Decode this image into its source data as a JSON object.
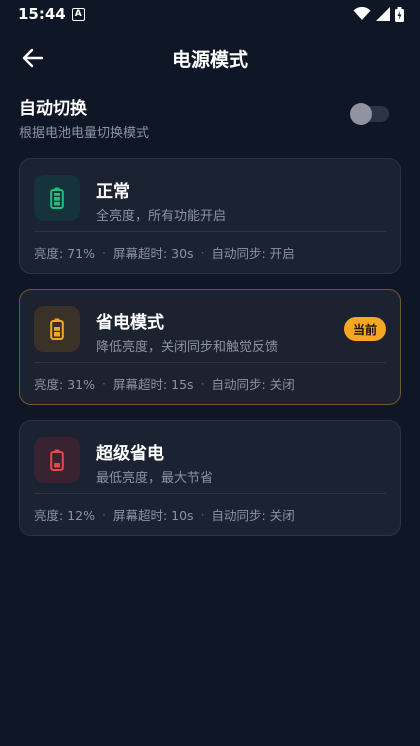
{
  "status_bar": {
    "time": "15:44",
    "a_label": "A"
  },
  "app_bar": {
    "title": "电源模式"
  },
  "auto_switch": {
    "title": "自动切换",
    "subtitle": "根据电池电量切换模式",
    "enabled": false
  },
  "modes": [
    {
      "title": "正常",
      "desc": "全亮度，所有功能开启",
      "stats": [
        "亮度: 71%",
        "屏幕超时: 30s",
        "自动同步: 开启"
      ],
      "color": "#21c07a",
      "icon_bg": "#16323a",
      "current": false
    },
    {
      "title": "省电模式",
      "desc": "降低亮度，关闭同步和触觉反馈",
      "stats": [
        "亮度: 31%",
        "屏幕超时: 15s",
        "自动同步: 关闭"
      ],
      "color": "#f5a623",
      "icon_bg": "#3a3226",
      "current": true,
      "badge": "当前"
    },
    {
      "title": "超级省电",
      "desc": "最低亮度，最大节省",
      "stats": [
        "亮度: 12%",
        "屏幕超时: 10s",
        "自动同步: 关闭"
      ],
      "color": "#e5484d",
      "icon_bg": "#3a2330",
      "current": false
    }
  ],
  "icons": {
    "back": "arrow-left-icon",
    "wifi": "wifi-icon",
    "signal": "signal-icon",
    "battery": "battery-icon",
    "mode": "battery-icon"
  }
}
